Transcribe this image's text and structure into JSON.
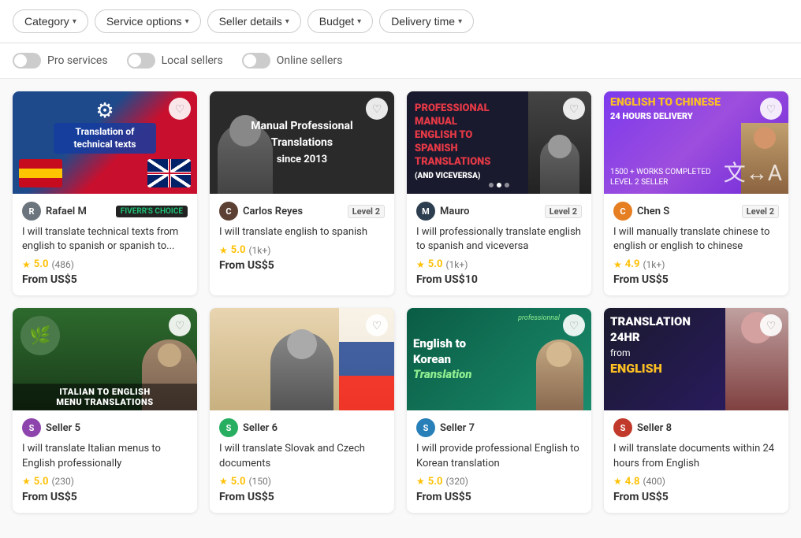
{
  "filters": {
    "buttons": [
      {
        "id": "category",
        "label": "Category"
      },
      {
        "id": "service-options",
        "label": "Service options"
      },
      {
        "id": "seller-details",
        "label": "Seller details"
      },
      {
        "id": "budget",
        "label": "Budget"
      },
      {
        "id": "delivery-time",
        "label": "Delivery time"
      }
    ]
  },
  "toggles": [
    {
      "id": "pro",
      "label": "Pro services",
      "on": false
    },
    {
      "id": "local",
      "label": "Local sellers",
      "on": false
    },
    {
      "id": "online",
      "label": "Online sellers",
      "on": false
    }
  ],
  "rows": [
    {
      "cards": [
        {
          "id": "card-1",
          "image_type": "technical",
          "title_overlay": "Translation of technical texts",
          "seller": "Rafael M",
          "badge": "FIVERR'S CHOICE",
          "badge_type": "fiverrs",
          "level": "",
          "desc": "I will translate technical texts from english to spanish or spanish to...",
          "rating": "5.0",
          "count": "(486)",
          "price": "From US$5"
        },
        {
          "id": "card-2",
          "image_type": "manual",
          "title_overlay": "Manual Professional Translations since 2013",
          "seller": "Carlos Reyes",
          "badge": "Level 2",
          "badge_type": "level",
          "level": "Level 2",
          "desc": "I will translate english to spanish",
          "rating": "5.0",
          "count": "(1k+)",
          "price": "From US$5"
        },
        {
          "id": "card-3",
          "image_type": "spanish",
          "title_overlay": "PROFESSIONAL MANUAL ENGLISH TO SPANISH TRANSLATIONS (AND VICEVERSA)",
          "seller": "Mauro",
          "badge": "Level 2",
          "badge_type": "level",
          "level": "Level 2",
          "desc": "I will professionally translate english to spanish and viceversa",
          "rating": "5.0",
          "count": "(1k+)",
          "price": "From US$10"
        },
        {
          "id": "card-4",
          "image_type": "chinese",
          "title_overlay": "ENGLISH TO CHINESE 24 HOURS DELIVERY",
          "subtitle": "1500+ WORKS COMPLETED\nLEVEL 2 SELLER",
          "seller": "Chen S",
          "badge": "Level 2",
          "badge_type": "level",
          "level": "Level 2",
          "desc": "I will manually translate chinese to english or english to chinese",
          "rating": "4.9",
          "count": "(1k+)",
          "price": "From US$5"
        }
      ]
    },
    {
      "cards": [
        {
          "id": "card-5",
          "image_type": "italian",
          "title_overlay": "ITALIAN TO ENGLISH MENU TRANSLATIONS",
          "seller": "Seller 5",
          "badge": "",
          "badge_type": "",
          "level": "",
          "desc": "I will translate Italian menus to English professionally",
          "rating": "5.0",
          "count": "(230)",
          "price": "From US$5"
        },
        {
          "id": "card-6",
          "image_type": "slovak",
          "title_overlay": "",
          "seller": "Seller 6",
          "badge": "",
          "badge_type": "",
          "level": "",
          "desc": "I will translate Slovak and Czech documents",
          "rating": "5.0",
          "count": "(150)",
          "price": "From US$5"
        },
        {
          "id": "card-7",
          "image_type": "korean",
          "title_overlay": "English to Korean Translation",
          "seller": "Seller 7",
          "badge": "",
          "badge_type": "",
          "level": "",
          "desc": "I will provide professional English to Korean translation",
          "rating": "5.0",
          "count": "(320)",
          "price": "From US$5"
        },
        {
          "id": "card-8",
          "image_type": "24hr",
          "title_overlay": "TRANSLATION 24HR from ENGLISH",
          "seller": "Seller 8",
          "badge": "",
          "badge_type": "",
          "level": "",
          "desc": "I will translate documents within 24 hours from English",
          "rating": "4.8",
          "count": "(400)",
          "price": "From US$5"
        }
      ]
    }
  ],
  "labels": {
    "from": "From",
    "level": "Level 2",
    "heart": "♡"
  }
}
